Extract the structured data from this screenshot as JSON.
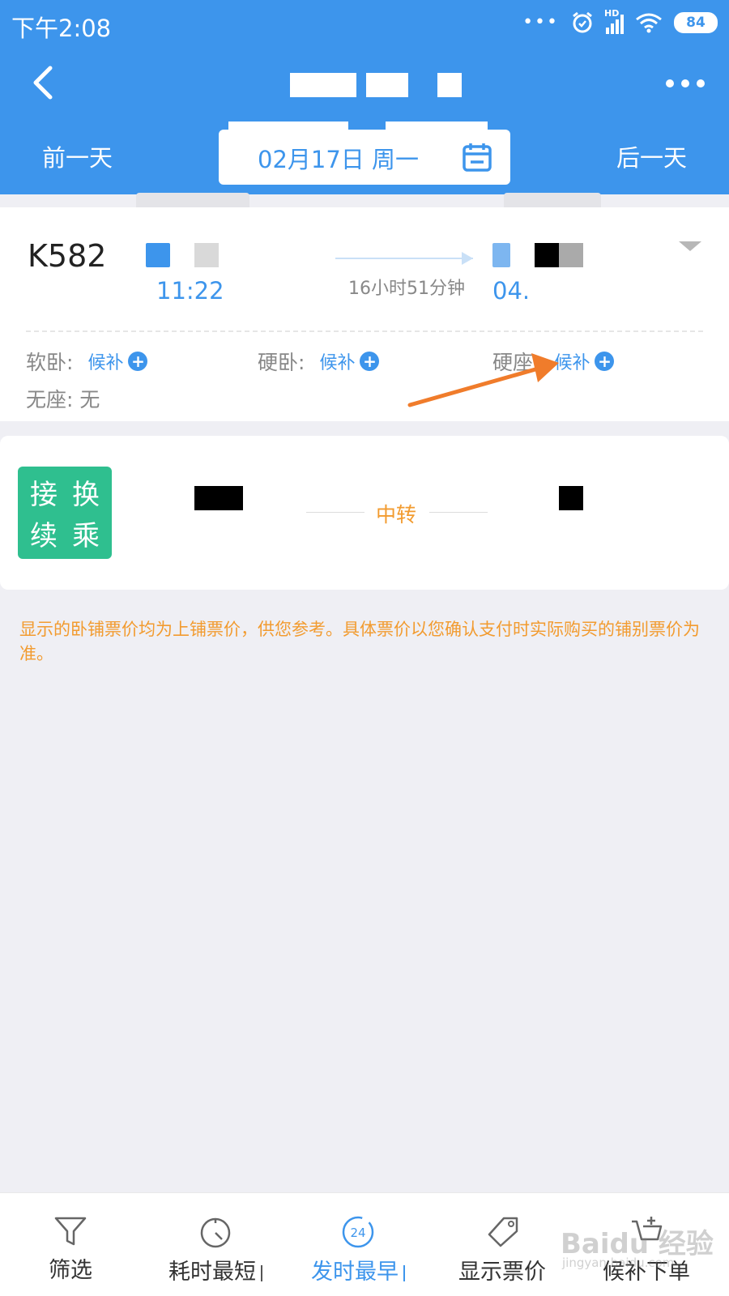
{
  "status_bar": {
    "time": "下午2:08",
    "signal_label": "HD",
    "battery": "84"
  },
  "nav": {
    "prev_day": "前一天",
    "date": "02月17日 周一",
    "next_day": "后一天"
  },
  "train": {
    "number": "K582",
    "departure_time": "11:22",
    "duration": "16小时51分钟",
    "arrival_time": "04.",
    "seats": [
      {
        "type": "软卧:",
        "status": "候补"
      },
      {
        "type": "硬卧:",
        "status": "候补"
      },
      {
        "type": "硬座:",
        "status": "候补"
      }
    ],
    "no_seat": "无座: 无"
  },
  "transfer": {
    "badge_chars": [
      "接",
      "换",
      "续",
      "乘"
    ],
    "middle_label": "中转"
  },
  "notice": "显示的卧铺票价均为上铺票价，供您参考。具体票价以您确认支付时实际购买的铺别票价为准。",
  "bottom_tabs": [
    {
      "label": "筛选",
      "icon": "filter-icon"
    },
    {
      "label": "耗时最短",
      "icon": "stopwatch-icon"
    },
    {
      "label": "发时最早",
      "icon": "clock-24-icon"
    },
    {
      "label": "显示票价",
      "icon": "price-tag-icon"
    },
    {
      "label": "候补下单",
      "icon": "cart-add-icon"
    }
  ],
  "watermark": "Baidu 经验",
  "watermark_url": "jingyan.baidu.com",
  "colors": {
    "primary": "#3d95ec",
    "accent": "#f29b2f",
    "badge": "#2fbf8f"
  }
}
